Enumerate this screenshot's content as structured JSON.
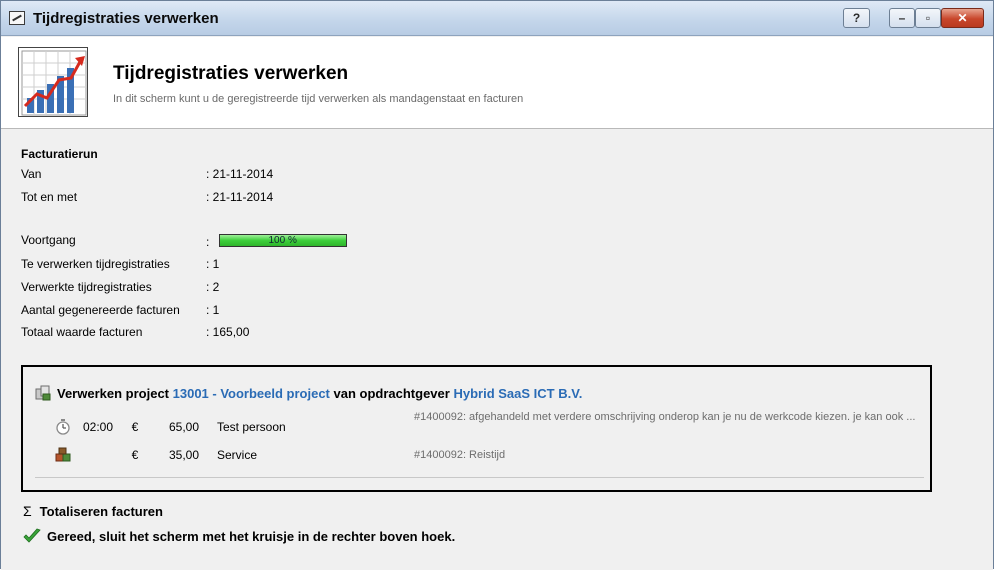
{
  "window": {
    "title": "Tijdregistraties verwerken",
    "help_label": "?",
    "min_label": "–",
    "max_label": "▫",
    "close_label": "✕"
  },
  "header": {
    "title": "Tijdregistraties verwerken",
    "subtitle": "In dit scherm kunt u de geregistreerde tijd verwerken als mandagenstaat en facturen"
  },
  "run": {
    "section_title": "Facturatierun",
    "van_label": "Van",
    "van_value": ": 21-11-2014",
    "tot_label": "Tot en met",
    "tot_value": ": 21-11-2014",
    "progress_label": "Voortgang",
    "progress_colon": ":",
    "progress_percent": 100,
    "progress_text": "100 %",
    "te_verwerken_label": "Te verwerken tijdregistraties",
    "te_verwerken_value": ": 1",
    "verwerkte_label": "Verwerkte tijdregistraties",
    "verwerkte_value": ": 2",
    "aantal_label": "Aantal gegenereerde facturen",
    "aantal_value": ": 1",
    "totaal_label": "Totaal waarde facturen",
    "totaal_value": ": 165,00"
  },
  "project": {
    "prefix": "Verwerken project",
    "project_link": "13001 - Voorbeeld project",
    "middle": "van opdrachtgever",
    "client_link": "Hybrid SaaS ICT B.V.",
    "entries": [
      {
        "icon": "stopwatch-icon",
        "time": "02:00",
        "currency": "€",
        "amount": "65,00",
        "who": "Test persoon",
        "desc": "#1400092: afgehandeld met verdere omschrijving onderop kan je nu de werkcode kiezen. je kan ook ..."
      },
      {
        "icon": "boxes-icon",
        "time": "",
        "currency": "€",
        "amount": "35,00",
        "who": "Service",
        "desc": "#1400092: Reistijd"
      }
    ]
  },
  "footer": {
    "sigma": "Σ",
    "totaliseren": "Totaliseren facturen",
    "gereed": "Gereed, sluit het scherm met het kruisje in de rechter boven hoek."
  },
  "colors": {
    "link": "#2a6bb5",
    "progress": "#3ccf3a",
    "check": "#3aa53a"
  }
}
